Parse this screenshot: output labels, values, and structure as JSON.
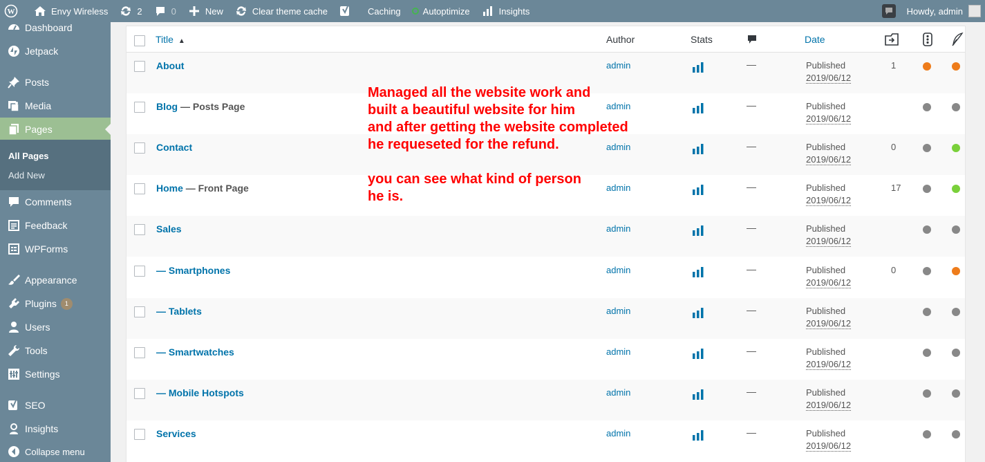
{
  "adminbar": {
    "site_name": "Envy Wireless",
    "updates_count": "2",
    "comments_count": "0",
    "new_label": "New",
    "clear_cache_label": "Clear theme cache",
    "caching_label": "Caching",
    "autoptimize_label": "Autoptimize",
    "insights_label": "Insights",
    "howdy_label": "Howdy, admin"
  },
  "sidebar": {
    "items": {
      "dashboard": "Dashboard",
      "jetpack": "Jetpack",
      "posts": "Posts",
      "media": "Media",
      "pages": "Pages",
      "comments": "Comments",
      "feedback": "Feedback",
      "wpforms": "WPForms",
      "appearance": "Appearance",
      "plugins": "Plugins",
      "plugins_badge": "1",
      "users": "Users",
      "tools": "Tools",
      "settings": "Settings",
      "seo": "SEO",
      "insights": "Insights",
      "collapse": "Collapse menu"
    },
    "submenu": {
      "all_pages": "All Pages",
      "add_new": "Add New"
    }
  },
  "table": {
    "headers": {
      "title": "Title",
      "title_sort": "▲",
      "author": "Author",
      "stats": "Stats",
      "date": "Date"
    },
    "rows": [
      {
        "title": "About",
        "state": "",
        "author": "admin",
        "comments": "—",
        "status": "Published",
        "date": "2019/06/12",
        "links": "1",
        "seo_dot": "orange",
        "read_dot": "orange"
      },
      {
        "title": "Blog",
        "state": " — Posts Page",
        "author": "admin",
        "comments": "—",
        "status": "Published",
        "date": "2019/06/12",
        "links": "",
        "seo_dot": "grey",
        "read_dot": "grey"
      },
      {
        "title": "Contact",
        "state": "",
        "author": "admin",
        "comments": "—",
        "status": "Published",
        "date": "2019/06/12",
        "links": "0",
        "seo_dot": "grey",
        "read_dot": "green"
      },
      {
        "title": "Home",
        "state": " — Front Page",
        "author": "admin",
        "comments": "—",
        "status": "Published",
        "date": "2019/06/12",
        "links": "17",
        "seo_dot": "grey",
        "read_dot": "green"
      },
      {
        "title": "Sales",
        "state": "",
        "author": "admin",
        "comments": "—",
        "status": "Published",
        "date": "2019/06/12",
        "links": "",
        "seo_dot": "grey",
        "read_dot": "grey"
      },
      {
        "title": "— Smartphones",
        "state": "",
        "author": "admin",
        "comments": "—",
        "status": "Published",
        "date": "2019/06/12",
        "links": "0",
        "seo_dot": "grey",
        "read_dot": "orange"
      },
      {
        "title": "— Tablets",
        "state": "",
        "author": "admin",
        "comments": "—",
        "status": "Published",
        "date": "2019/06/12",
        "links": "",
        "seo_dot": "grey",
        "read_dot": "grey"
      },
      {
        "title": "— Smartwatches",
        "state": "",
        "author": "admin",
        "comments": "—",
        "status": "Published",
        "date": "2019/06/12",
        "links": "",
        "seo_dot": "grey",
        "read_dot": "grey"
      },
      {
        "title": "— Mobile Hotspots",
        "state": "",
        "author": "admin",
        "comments": "—",
        "status": "Published",
        "date": "2019/06/12",
        "links": "",
        "seo_dot": "grey",
        "read_dot": "grey"
      },
      {
        "title": "Services",
        "state": "",
        "author": "admin",
        "comments": "—",
        "status": "Published",
        "date": "2019/06/12",
        "links": "",
        "seo_dot": "grey",
        "read_dot": "grey"
      }
    ]
  },
  "annotation": {
    "line1": "Managed all the website work and",
    "line2": "built a beautiful website for him",
    "line3": "and after getting the website completed",
    "line4": "he requeseted for the refund.",
    "line5": "you can see what kind of person",
    "line6": "he is."
  },
  "colors": {
    "adminbar_bg": "#6b8798",
    "menu_current": "#9cbf93",
    "link": "#0073aa",
    "annotation": "#ff0000",
    "dot_orange": "#ee7c1b",
    "dot_green": "#7ad03a",
    "dot_grey": "#888888"
  }
}
